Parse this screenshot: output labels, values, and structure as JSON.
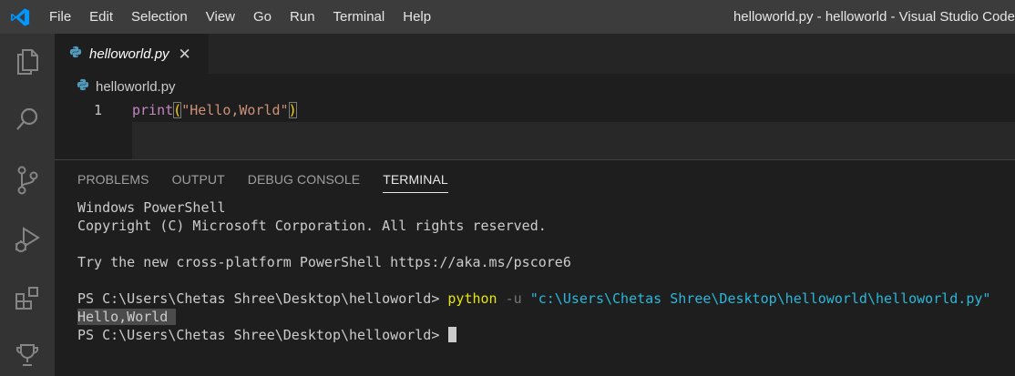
{
  "titlebar": {
    "menu": [
      "File",
      "Edit",
      "Selection",
      "View",
      "Go",
      "Run",
      "Terminal",
      "Help"
    ],
    "window_title": "helloworld.py - helloworld - Visual Studio Code"
  },
  "activitybar": {
    "icons": [
      "explorer-icon",
      "search-icon",
      "source-control-icon",
      "run-debug-icon",
      "extensions-icon",
      "testing-icon"
    ]
  },
  "editor": {
    "tab_label": "helloworld.py",
    "breadcrumb": "helloworld.py",
    "lines": [
      {
        "number": "1",
        "fn": "print",
        "open": "(",
        "str": "\"Hello,World\"",
        "close": ")"
      }
    ]
  },
  "panel": {
    "tabs": [
      "PROBLEMS",
      "OUTPUT",
      "DEBUG CONSOLE",
      "TERMINAL"
    ],
    "active_tab": "TERMINAL"
  },
  "terminal": {
    "line1": "Windows PowerShell",
    "line2": "Copyright (C) Microsoft Corporation. All rights reserved.",
    "line3": "",
    "line4": "Try the new cross-platform PowerShell https://aka.ms/pscore6",
    "line5": "",
    "prompt1": "PS C:\\Users\\Chetas Shree\\Desktop\\helloworld> ",
    "cmd": "python",
    "flag": " -u ",
    "arg": "\"c:\\Users\\Chetas Shree\\Desktop\\helloworld\\helloworld.py\"",
    "output": "Hello,World ",
    "prompt2": "PS C:\\Users\\Chetas Shree\\Desktop\\helloworld> "
  },
  "colors": {
    "accent": "#0098ff",
    "python_blue": "#519aba",
    "titlebar_bg": "#3c3c3c",
    "activitybar_bg": "#333333"
  }
}
